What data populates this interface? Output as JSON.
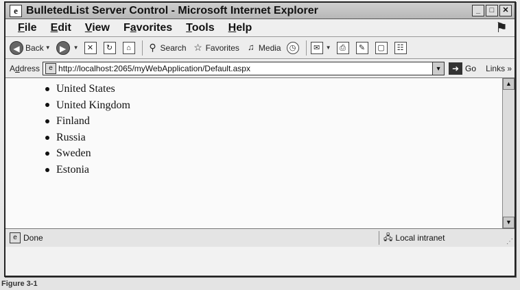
{
  "window": {
    "title": "BulletedList Server Control - Microsoft Internet Explorer",
    "icon_letter": "e",
    "controls": [
      "_",
      "□",
      "✕"
    ]
  },
  "menu": {
    "items": [
      {
        "first": "F",
        "rest": "ile"
      },
      {
        "first": "E",
        "rest": "dit"
      },
      {
        "first": "V",
        "rest": "iew"
      },
      {
        "first": "F",
        "rest": "a",
        "third": "v",
        "tail": "orites"
      },
      {
        "first": "T",
        "rest": "ools"
      },
      {
        "first": "H",
        "rest": "elp"
      }
    ]
  },
  "toolbar": {
    "back": "Back",
    "search": "Search",
    "favorites": "Favorites",
    "media": "Media"
  },
  "address": {
    "label_prefix": "A",
    "label_under": "d",
    "label_suffix": "dress",
    "url": "http://localhost:2065/myWebApplication/Default.aspx",
    "go": "Go",
    "links": "Links"
  },
  "list": {
    "items": [
      "United States",
      "United Kingdom",
      "Finland",
      "Russia",
      "Sweden",
      "Estonia"
    ]
  },
  "status": {
    "text": "Done",
    "zone": "Local intranet"
  },
  "caption": "Figure 3-1"
}
